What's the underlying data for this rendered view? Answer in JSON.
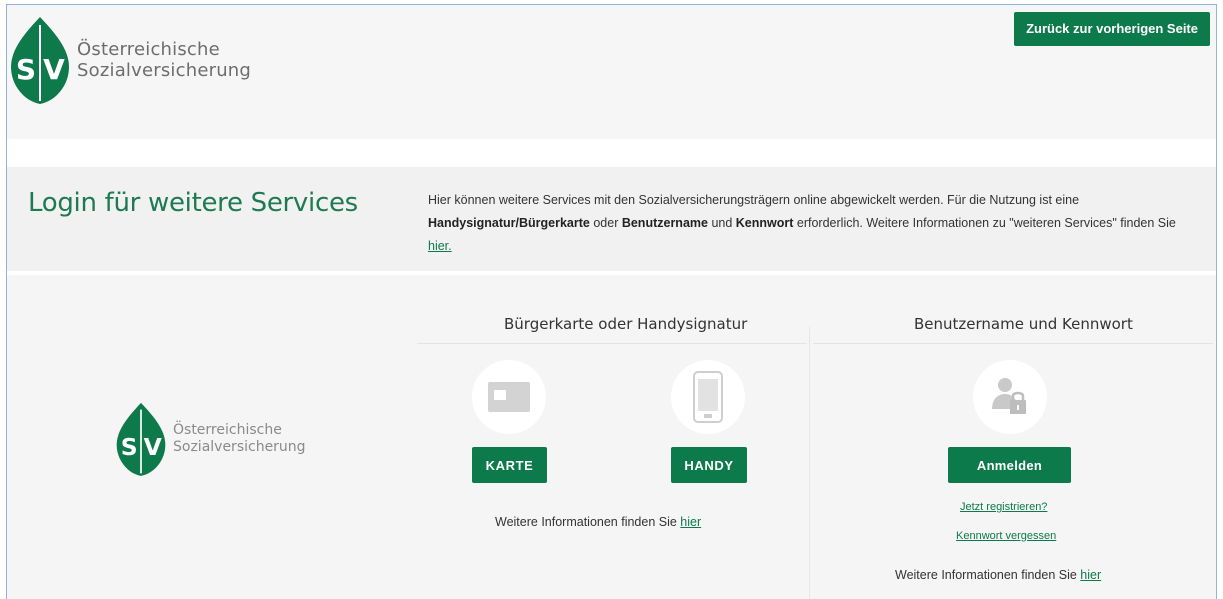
{
  "header": {
    "logo_letters": "SV",
    "brand_line1": "Österreichische",
    "brand_line2": "Sozialversicherung",
    "back_button": "Zurück zur vorherigen Seite"
  },
  "intro": {
    "title": "Login für weitere Services",
    "p1": "Hier können weitere Services mit den Sozialversicherungsträgern online abgewickelt werden. Für die Nutzung ist eine ",
    "b1": "Handysignatur/Bürgerkarte",
    "p2": " oder ",
    "b2": "Benutzername",
    "p3": " und ",
    "b3": "Kennwort",
    "p4": " erforderlich. Weitere Informationen zu \"weiteren Services\" finden Sie ",
    "link": "hier."
  },
  "citizen_card": {
    "heading": "Bürgerkarte oder Handysignatur",
    "card_button": "KARTE",
    "handy_button": "HANDY",
    "info_text": "Weitere Informationen finden Sie ",
    "info_link": "hier"
  },
  "credentials": {
    "heading": "Benutzername und Kennwort",
    "login_button": "Anmelden",
    "register_link": "Jetzt registrieren?",
    "forgot_link": "Kennwort vergessen",
    "info_text": "Weitere Informationen finden Sie ",
    "info_link": "hier"
  },
  "colors": {
    "brand_green": "#0c7a4a",
    "title_green": "#1e7a52"
  }
}
